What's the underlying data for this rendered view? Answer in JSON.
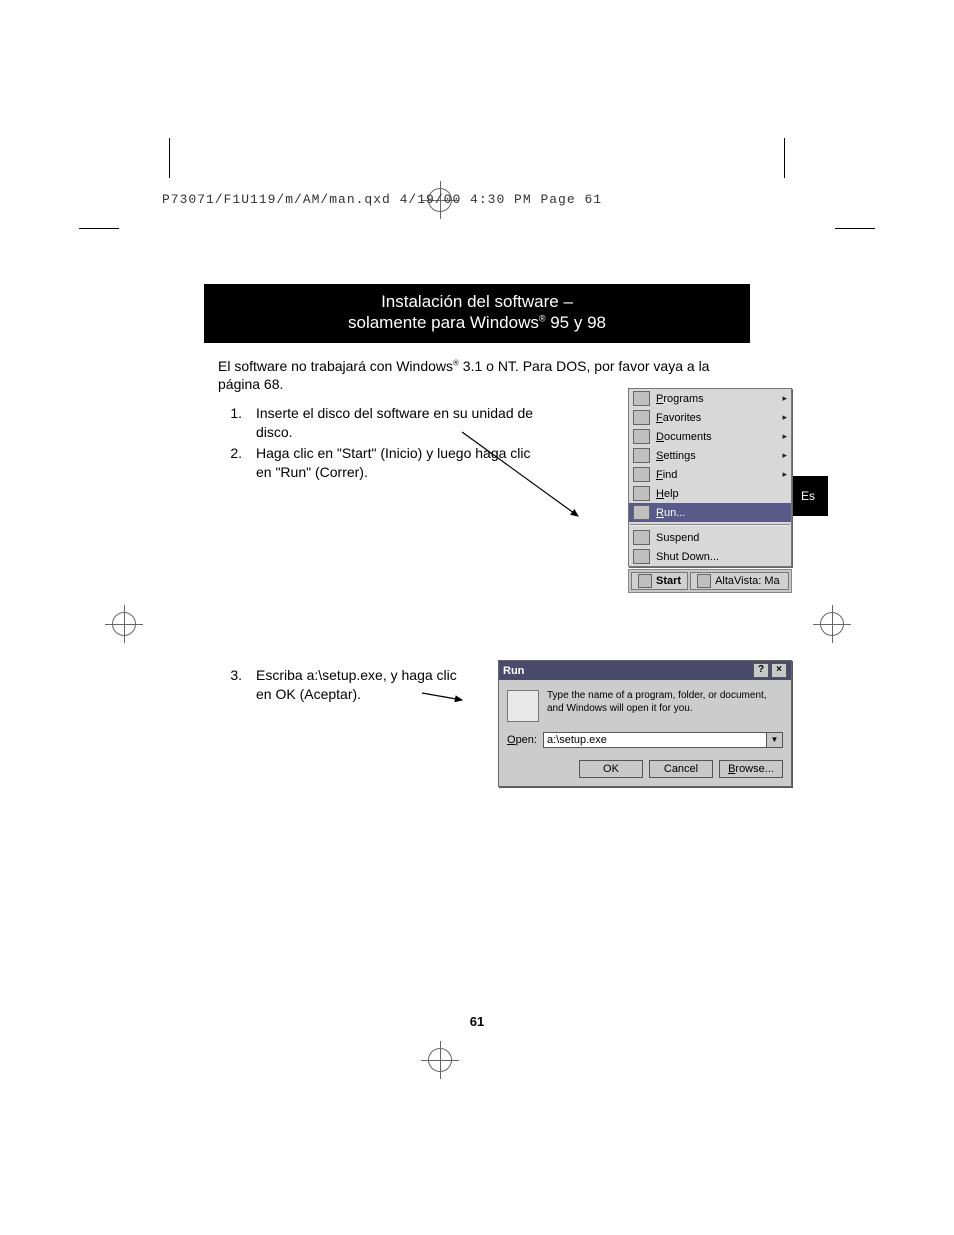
{
  "header": {
    "slug": "P73071/F1U119/m/AM/man.qxd  4/19/00  4:30 PM  Page 61"
  },
  "title": {
    "line1": "Instalación del software –",
    "line2_pre": "solamente para Windows",
    "line2_sup": "®",
    "line2_post": " 95 y 98"
  },
  "intro": {
    "pre": "El software no trabajará con Windows",
    "sup": "®",
    "post": " 3.1 o NT. Para DOS, por favor vaya a la página 68."
  },
  "steps": [
    {
      "num": "1.",
      "text": "Inserte el disco del software en su unidad de disco."
    },
    {
      "num": "2.",
      "text": "Haga clic en \"Start\" (Inicio) y luego haga clic en \"Run\" (Correr)."
    }
  ],
  "step3": {
    "num": "3.",
    "text": "Escriba a:\\setup.exe, y haga clic en OK (Aceptar)."
  },
  "lang_tab": "Es",
  "start_menu": {
    "items": [
      {
        "label_u": "P",
        "label_rest": "rograms",
        "sub": true
      },
      {
        "label_u": "F",
        "label_rest": "avorites",
        "sub": true,
        "pre": ""
      },
      {
        "label_u": "D",
        "label_rest": "ocuments",
        "sub": true
      },
      {
        "label_u": "S",
        "label_rest": "ettings",
        "sub": true
      },
      {
        "label_u": "F",
        "label_rest": "ind",
        "sub": true
      },
      {
        "label_u": "H",
        "label_rest": "elp",
        "sub": false
      },
      {
        "label_u": "R",
        "label_rest": "un...",
        "sub": false,
        "selected": true
      }
    ],
    "lower": [
      {
        "label": "Suspend"
      },
      {
        "label": "Shut Down..."
      }
    ],
    "taskbar": {
      "start": "Start",
      "task": "AltaVista: Ma"
    }
  },
  "run_dialog": {
    "title": "Run",
    "help_btn": "?",
    "close_btn": "×",
    "description": "Type the name of a program, folder, or document, and Windows will open it for you.",
    "open_label_u": "O",
    "open_label_rest": "pen:",
    "input_value": "a:\\setup.exe",
    "ok": "OK",
    "cancel": "Cancel",
    "browse_u": "B",
    "browse_rest": "rowse..."
  },
  "page_number": "61"
}
